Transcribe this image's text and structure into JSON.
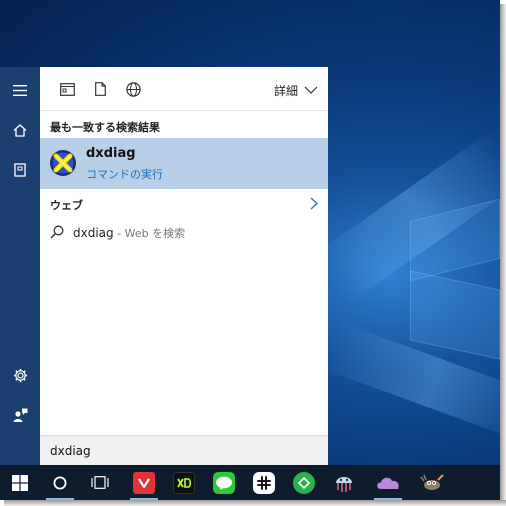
{
  "toolbar": {
    "filter_label": "詳細"
  },
  "best_match": {
    "header": "最も一致する検索結果",
    "title": "dxdiag",
    "subtitle": "コマンドの実行"
  },
  "web": {
    "header": "ウェブ",
    "result_query": "dxdiag",
    "result_suffix": " - Web を検索"
  },
  "search": {
    "value": "dxdiag"
  },
  "taskbar": {
    "apps": [
      {
        "name": "vivaldi",
        "color": "#e0343b",
        "glyph": "V"
      },
      {
        "name": "xd",
        "color": "#1d1d1d",
        "glyph": "XD"
      },
      {
        "name": "line",
        "color": "#2fc73a",
        "glyph": "LINE"
      },
      {
        "name": "slack",
        "color": "#ffffff",
        "glyph": "#"
      },
      {
        "name": "feedly",
        "color": "#2bb24c",
        "glyph": "f"
      },
      {
        "name": "jellyfish",
        "color": "#6b8fd8",
        "glyph": "J"
      },
      {
        "name": "onedrive",
        "color": "#b58ad8",
        "glyph": "☁"
      },
      {
        "name": "gimp",
        "color": "#7a6a55",
        "glyph": "G"
      }
    ]
  },
  "colors": {
    "highlight": "#b7d0e8",
    "accent_link": "#1a6fb6",
    "rail": "#1b3f6e",
    "taskbar": "#0f1c2e"
  }
}
